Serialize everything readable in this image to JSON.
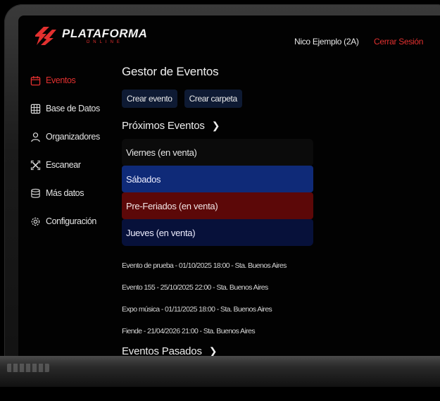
{
  "header": {
    "logo_title": "PLATAFORMA",
    "logo_subtitle": "ONLINE",
    "user_name": "Nico Ejemplo (2A)",
    "logout_label": "Cerrar Sesión"
  },
  "sidebar": {
    "items": [
      {
        "label": "Eventos",
        "icon": "calendar-icon",
        "active": true
      },
      {
        "label": "Base de Datos",
        "icon": "database-grid-icon",
        "active": false
      },
      {
        "label": "Organizadores",
        "icon": "users-icon",
        "active": false
      },
      {
        "label": "Escanear",
        "icon": "scan-x-icon",
        "active": false
      },
      {
        "label": "Más datos",
        "icon": "stack-icon",
        "active": false
      },
      {
        "label": "Configuración",
        "icon": "gear-icon",
        "active": false
      }
    ]
  },
  "main": {
    "title": "Gestor de Eventos",
    "actions": [
      {
        "label": "Crear evento"
      },
      {
        "label": "Crear carpeta"
      }
    ],
    "upcoming_heading": "Próximos Eventos",
    "folders": [
      {
        "label": "Viernes (en venta)",
        "color": "#0b0b0b"
      },
      {
        "label": "Sábados",
        "color": "#0f2a78"
      },
      {
        "label": "Pre-Feriados (en venta)",
        "color": "#5c0808"
      },
      {
        "label": "Jueves (en venta)",
        "color": "#07113a"
      }
    ],
    "events": [
      "Evento de prueba - 01/10/2025 18:00 - Sta. Buenos Aires",
      "Evento 155 - 25/10/2025 22:00 - Sta. Buenos Aires",
      "Expo música - 01/11/2025 18:00 - Sta. Buenos Aires",
      "Fiende - 21/04/2026 21:00 - Sta. Buenos Aires"
    ],
    "past_heading": "Eventos Pasados"
  },
  "colors": {
    "accent": "#e2302f",
    "button_bg": "#0e1a33"
  }
}
